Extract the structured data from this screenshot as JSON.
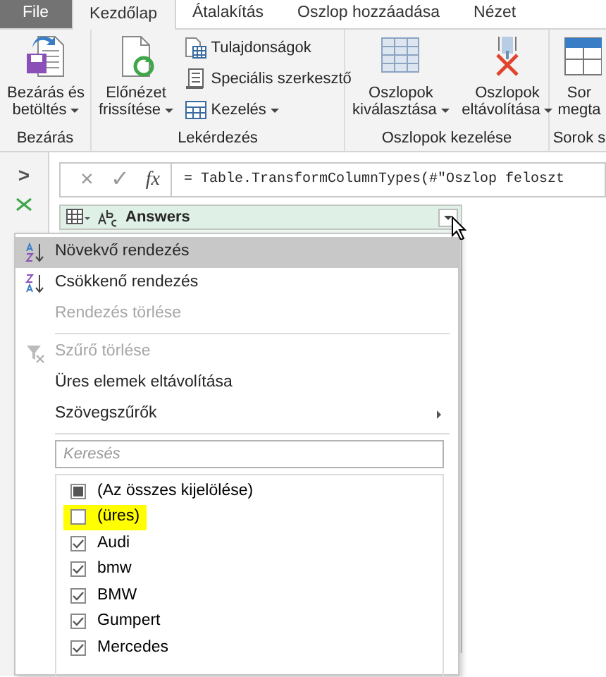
{
  "tabs": [
    {
      "label": "File",
      "kind": "file",
      "selected": false
    },
    {
      "label": "Kezdőlap",
      "kind": "tab",
      "selected": true
    },
    {
      "label": "Átalakítás",
      "kind": "tab",
      "selected": false
    },
    {
      "label": "Oszlop hozzáadása",
      "kind": "tab",
      "selected": false
    },
    {
      "label": "Nézet",
      "kind": "tab",
      "selected": false
    }
  ],
  "ribbon_groups": [
    {
      "label": "Bezárás",
      "buttons": [
        {
          "kind": "large",
          "label": "Bezárás és\nbetöltés",
          "dropdown": true
        }
      ]
    },
    {
      "label": "Lekérdezés",
      "buttons": [
        {
          "kind": "large",
          "label": "Előnézet\nfrissítése",
          "dropdown": true
        },
        {
          "kind": "small",
          "label": "Tulajdonságok",
          "dropdown": false
        },
        {
          "kind": "small",
          "label": "Speciális szerkesztő",
          "dropdown": false
        },
        {
          "kind": "small",
          "label": "Kezelés",
          "dropdown": true
        }
      ]
    },
    {
      "label": "Oszlopok kezelése",
      "buttons": [
        {
          "kind": "large",
          "label": "Oszlopok\nkiválasztása",
          "dropdown": true
        },
        {
          "kind": "large",
          "label": "Oszlopok\neltávolítása",
          "dropdown": true
        }
      ]
    },
    {
      "label": "Sorok s",
      "buttons": [
        {
          "kind": "large",
          "label": "Sor\nmegta",
          "dropdown": false
        }
      ]
    }
  ],
  "sidebar": {
    "toggle": ">"
  },
  "formula_bar": {
    "cancel": "×",
    "confirm": "✓",
    "fx": "fx",
    "formula": "= Table.TransformColumnTypes(#\"Oszlop feloszt"
  },
  "column": {
    "name": "Answers"
  },
  "filter_menu": {
    "items": [
      {
        "kind": "item",
        "label": "Növekvő rendezés",
        "highlighted": true,
        "disabled": false,
        "submenu": false
      },
      {
        "kind": "item",
        "label": "Csökkenő rendezés",
        "highlighted": false,
        "disabled": false,
        "submenu": false
      },
      {
        "kind": "item",
        "label": "Rendezés törlése",
        "highlighted": false,
        "disabled": true,
        "submenu": false
      },
      {
        "kind": "separator"
      },
      {
        "kind": "item",
        "label": "Szűrő törlése",
        "highlighted": false,
        "disabled": true,
        "submenu": false
      },
      {
        "kind": "item",
        "label": "Üres elemek eltávolítása",
        "highlighted": false,
        "disabled": false,
        "submenu": false
      },
      {
        "kind": "item",
        "label": "Szövegszűrők",
        "highlighted": false,
        "disabled": false,
        "submenu": true
      },
      {
        "kind": "separator"
      }
    ],
    "search": {
      "placeholder": "Keresés"
    },
    "values": [
      {
        "label": "(Az összes kijelölése)",
        "checked": false,
        "mixed": true,
        "highlighted": false
      },
      {
        "label": "(üres)",
        "checked": false,
        "mixed": false,
        "highlighted": true
      },
      {
        "label": "Audi",
        "checked": true,
        "mixed": false,
        "highlighted": false
      },
      {
        "label": "bmw",
        "checked": true,
        "mixed": false,
        "highlighted": false
      },
      {
        "label": "BMW",
        "checked": true,
        "mixed": false,
        "highlighted": false
      },
      {
        "label": "Gumpert",
        "checked": true,
        "mixed": false,
        "highlighted": false
      },
      {
        "label": "Mercedes",
        "checked": true,
        "mixed": false,
        "highlighted": false
      }
    ]
  }
}
